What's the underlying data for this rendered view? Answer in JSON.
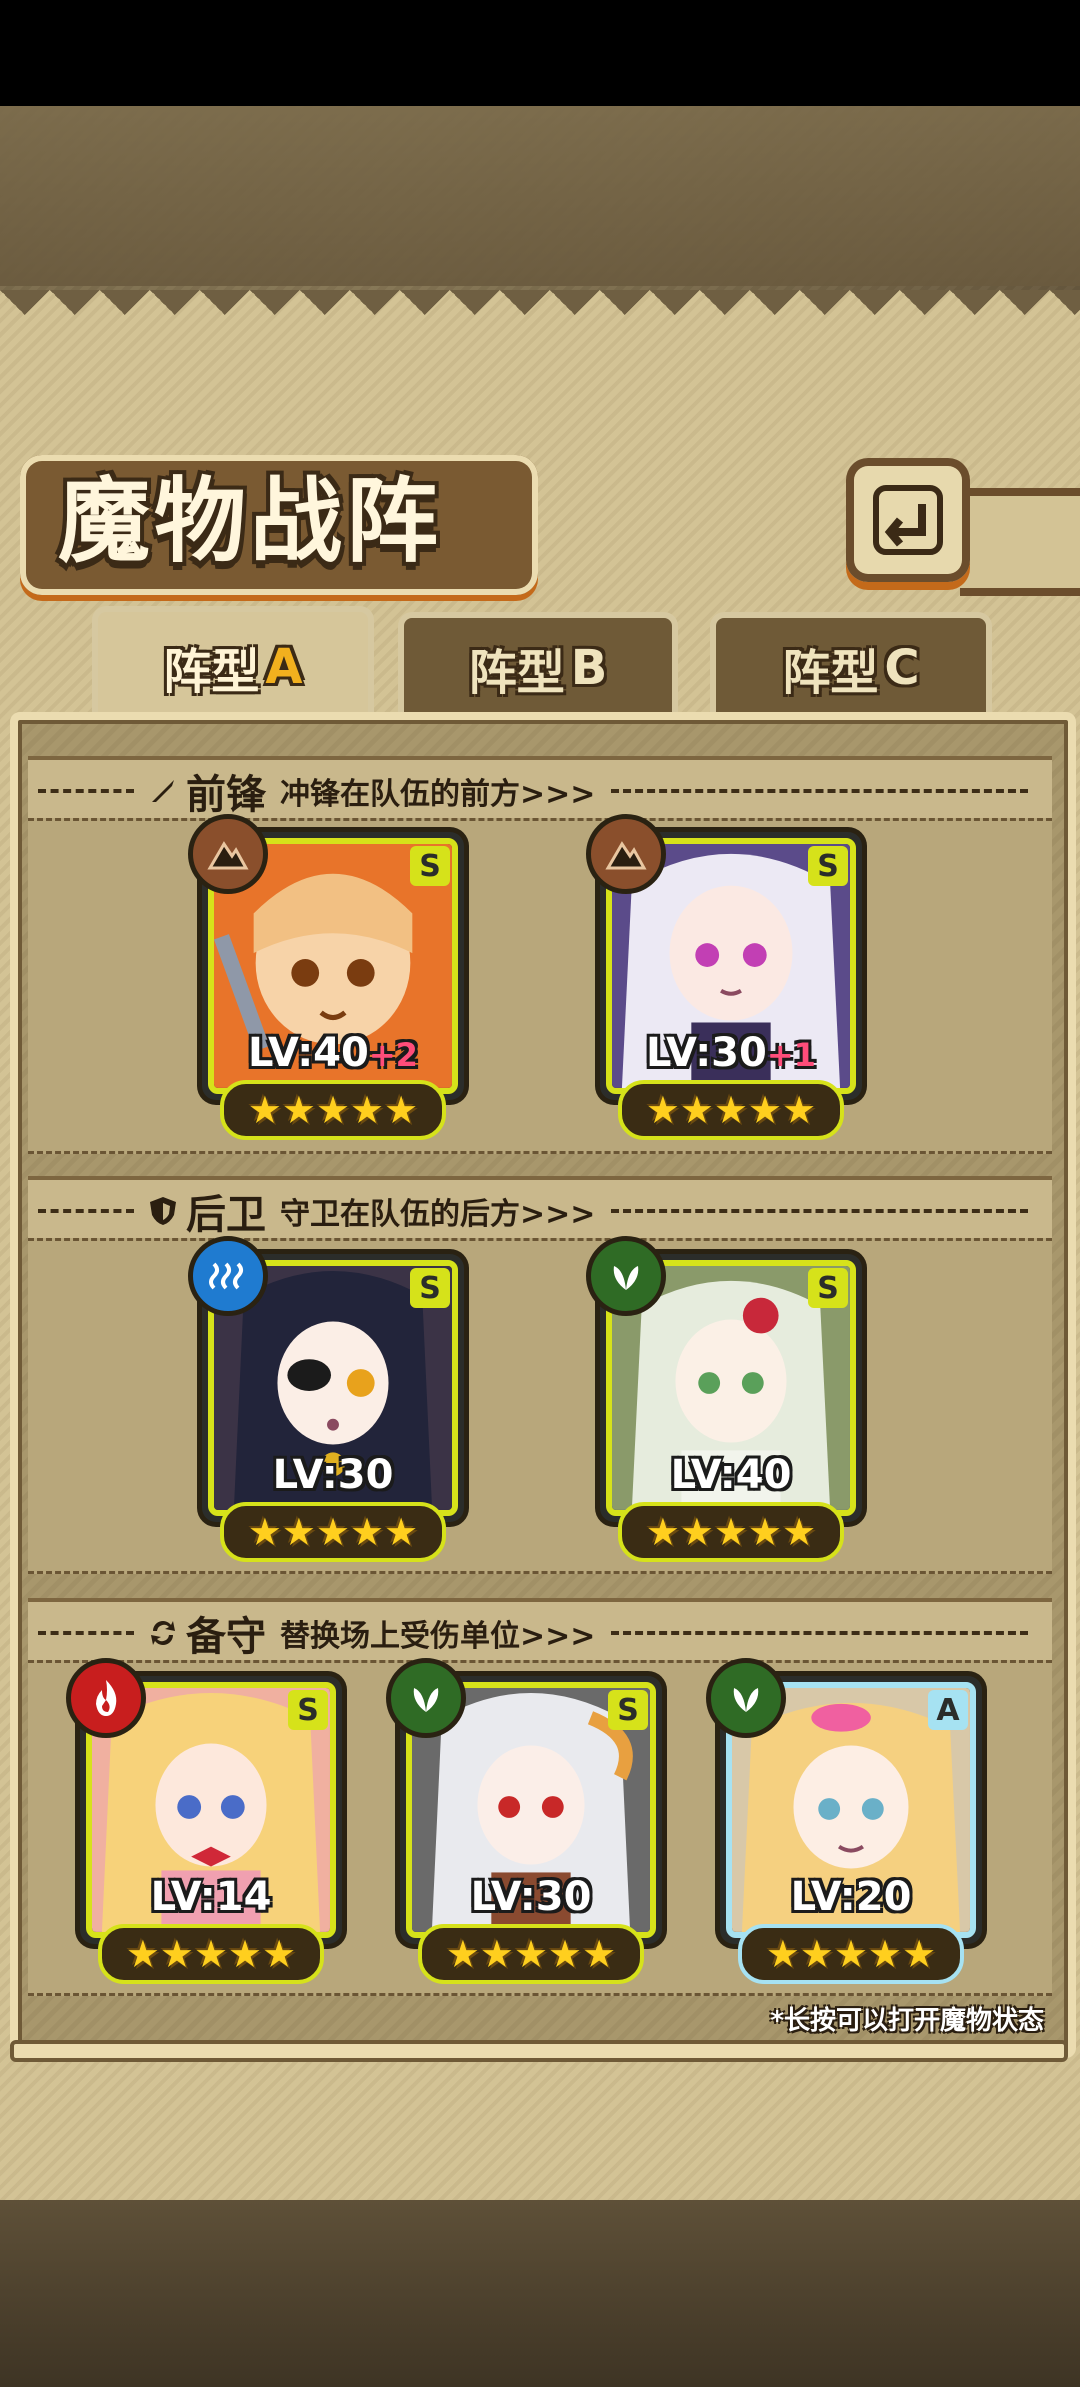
{
  "title": "魔物战阵",
  "tabs": [
    {
      "label": "阵型",
      "letter": "A",
      "active": true
    },
    {
      "label": "阵型",
      "letter": "B",
      "active": false
    },
    {
      "label": "阵型",
      "letter": "C",
      "active": false
    }
  ],
  "sections": {
    "front": {
      "title": "前锋",
      "subtitle": "冲锋在队伍的前方>>>"
    },
    "rear": {
      "title": "后卫",
      "subtitle": "守卫在队伍的后方>>>"
    },
    "reserve": {
      "title": "备守",
      "subtitle": "替换场上受伤单位>>>"
    }
  },
  "cards": {
    "front1": {
      "rank": "S",
      "lv": "LV:40",
      "plus": "+2",
      "stars": "★★★★★",
      "element": "earth",
      "color": "#8a4f2c"
    },
    "front2": {
      "rank": "S",
      "lv": "LV:30",
      "plus": "+1",
      "stars": "★★★★★",
      "element": "earth",
      "color": "#8a4f2c"
    },
    "rear1": {
      "rank": "S",
      "lv": "LV:30",
      "plus": "",
      "stars": "★★★★★",
      "element": "water",
      "color": "#1f7bd0"
    },
    "rear2": {
      "rank": "S",
      "lv": "LV:40",
      "plus": "",
      "stars": "★★★★★",
      "element": "wind",
      "color": "#2f6b25"
    },
    "res1": {
      "rank": "S",
      "lv": "LV:14",
      "plus": "",
      "stars": "★★★★★",
      "element": "fire",
      "color": "#c81e1e"
    },
    "res2": {
      "rank": "S",
      "lv": "LV:30",
      "plus": "",
      "stars": "★★★★★",
      "element": "wind",
      "color": "#2f6b25"
    },
    "res3": {
      "rank": "A",
      "lv": "LV:20",
      "plus": "",
      "stars": "★★★★★",
      "element": "wind",
      "color": "#2f6b25"
    }
  },
  "hint": "*长按可以打开魔物状态"
}
